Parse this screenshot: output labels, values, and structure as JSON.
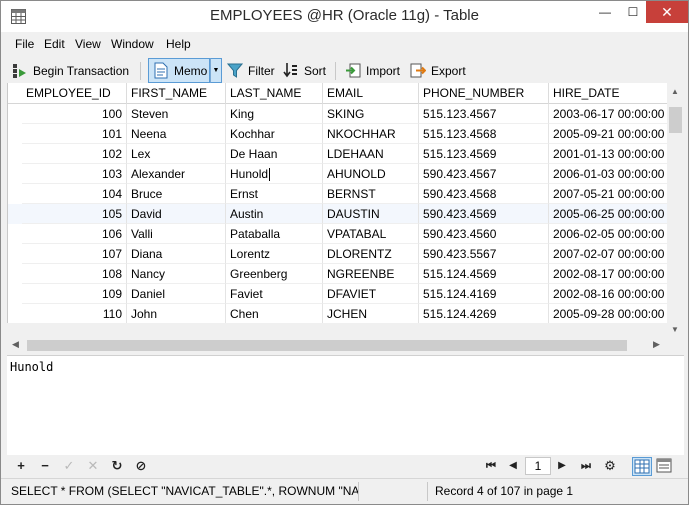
{
  "window": {
    "title": "EMPLOYEES @HR (Oracle 11g) - Table",
    "min": "—",
    "max": "☐",
    "close": "✕"
  },
  "menu": [
    "File",
    "Edit",
    "View",
    "Window",
    "Help"
  ],
  "toolbar": {
    "begin_transaction": "Begin Transaction",
    "memo": "Memo",
    "filter": "Filter",
    "sort": "Sort",
    "import": "Import",
    "export": "Export"
  },
  "grid": {
    "columns": [
      "EMPLOYEE_ID",
      "FIRST_NAME",
      "LAST_NAME",
      "EMAIL",
      "PHONE_NUMBER",
      "HIRE_DATE"
    ],
    "rows": [
      [
        "100",
        "Steven",
        "King",
        "SKING",
        "515.123.4567",
        "2003-06-17 00:00:00"
      ],
      [
        "101",
        "Neena",
        "Kochhar",
        "NKOCHHAR",
        "515.123.4568",
        "2005-09-21 00:00:00"
      ],
      [
        "102",
        "Lex",
        "De Haan",
        "LDEHAAN",
        "515.123.4569",
        "2001-01-13 00:00:00"
      ],
      [
        "103",
        "Alexander",
        "Hunold",
        "AHUNOLD",
        "590.423.4567",
        "2006-01-03 00:00:00"
      ],
      [
        "104",
        "Bruce",
        "Ernst",
        "BERNST",
        "590.423.4568",
        "2007-05-21 00:00:00"
      ],
      [
        "105",
        "David",
        "Austin",
        "DAUSTIN",
        "590.423.4569",
        "2005-06-25 00:00:00"
      ],
      [
        "106",
        "Valli",
        "Pataballa",
        "VPATABAL",
        "590.423.4560",
        "2006-02-05 00:00:00"
      ],
      [
        "107",
        "Diana",
        "Lorentz",
        "DLORENTZ",
        "590.423.5567",
        "2007-02-07 00:00:00"
      ],
      [
        "108",
        "Nancy",
        "Greenberg",
        "NGREENBE",
        "515.124.4569",
        "2002-08-17 00:00:00"
      ],
      [
        "109",
        "Daniel",
        "Faviet",
        "DFAVIET",
        "515.124.4169",
        "2002-08-16 00:00:00"
      ],
      [
        "110",
        "John",
        "Chen",
        "JCHEN",
        "515.124.4269",
        "2005-09-28 00:00:00"
      ]
    ],
    "current_row": 3
  },
  "memo": {
    "text": "Hunold"
  },
  "nav": {
    "add": "+",
    "delete": "−",
    "apply": "✓",
    "discard": "✕",
    "refresh": "↻",
    "stop": "⊘",
    "first": "⏮",
    "prev": "◀",
    "page": "1",
    "next": "▶",
    "last": "⏭",
    "settings": "⚙"
  },
  "status": {
    "sql": "SELECT * FROM (SELECT \"NAVICAT_TABLE\".*, ROWNUM \"NAVICAT_ROWNUM\" FROM",
    "record": "Record 4 of 107 in page 1"
  },
  "colors": {
    "accent": "#5a9bd5",
    "selected_bg": "#cce4f7",
    "close_red": "#c7403a"
  }
}
